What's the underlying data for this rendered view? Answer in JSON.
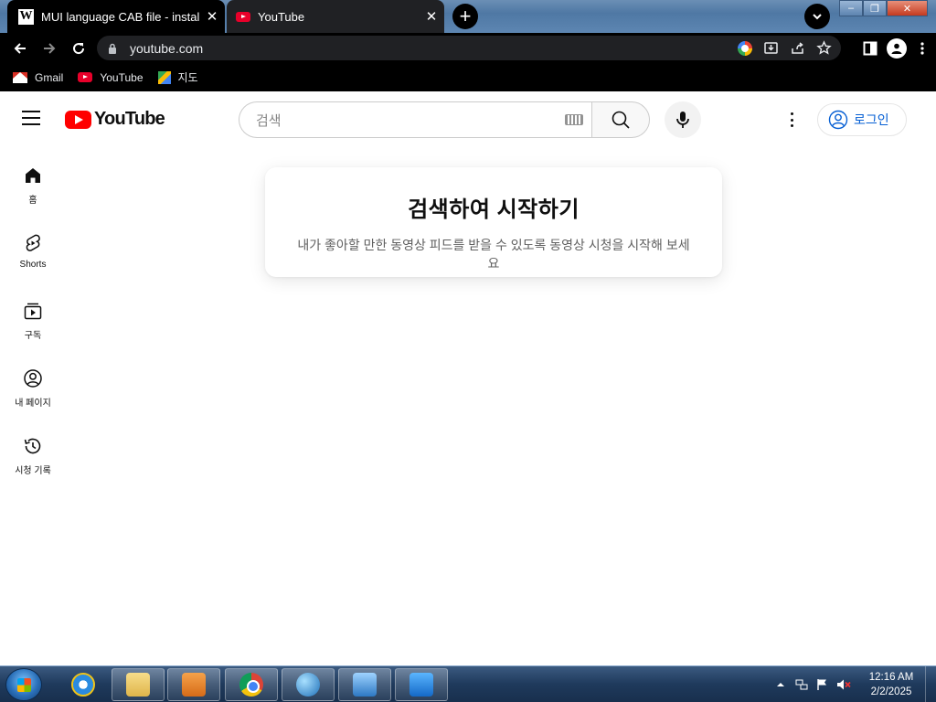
{
  "browser": {
    "tabs": [
      {
        "title": "MUI language CAB file - install in",
        "favicon": "wikipedia-w-icon",
        "close": "✕"
      },
      {
        "title": "YouTube",
        "favicon": "youtube-icon",
        "close": "✕"
      }
    ],
    "new_tab": "+",
    "url": "youtube.com",
    "bookmarks": [
      {
        "label": "Gmail",
        "icon": "gmail-icon"
      },
      {
        "label": "YouTube",
        "icon": "youtube-icon"
      },
      {
        "label": "지도",
        "icon": "maps-icon"
      }
    ]
  },
  "youtube": {
    "logo_text": "YouTube",
    "search_placeholder": "검색",
    "sign_in": "로그인",
    "sidebar": [
      {
        "label": "홈",
        "icon": "home-icon"
      },
      {
        "label": "Shorts",
        "icon": "shorts-icon"
      },
      {
        "label": "구독",
        "icon": "subscriptions-icon"
      },
      {
        "label": "내 페이지",
        "icon": "account-icon"
      },
      {
        "label": "시청 기록",
        "icon": "history-icon"
      }
    ],
    "prompt": {
      "title": "검색하여 시작하기",
      "body": "내가 좋아할 만한 동영상 피드를 받을 수 있도록 동영상 시청을 시작해 보세요"
    }
  },
  "taskbar": {
    "time": "12:16 AM",
    "date": "2/2/2025"
  }
}
